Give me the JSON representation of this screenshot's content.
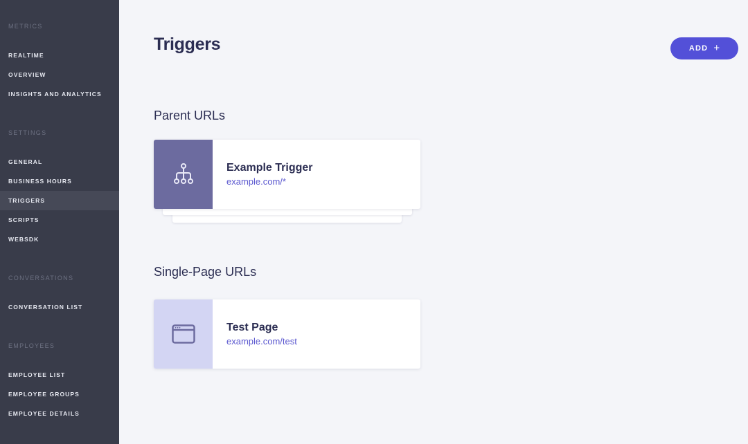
{
  "sidebar": {
    "sections": [
      {
        "header": "METRICS",
        "items": [
          "REALTIME",
          "OVERVIEW",
          "INSIGHTS AND ANALYTICS"
        ]
      },
      {
        "header": "SETTINGS",
        "items": [
          "GENERAL",
          "BUSINESS HOURS",
          "TRIGGERS",
          "SCRIPTS",
          "WEBSDK"
        ]
      },
      {
        "header": "CONVERSATIONS",
        "items": [
          "CONVERSATION LIST"
        ]
      },
      {
        "header": "EMPLOYEES",
        "items": [
          "EMPLOYEE LIST",
          "EMPLOYEE GROUPS",
          "EMPLOYEE DETAILS"
        ]
      }
    ],
    "active_item": "TRIGGERS"
  },
  "main": {
    "title": "Triggers",
    "add_button": {
      "label": "ADD",
      "icon": "plus-icon"
    },
    "parent_urls": {
      "title": "Parent URLs",
      "cards": [
        {
          "name": "Example Trigger",
          "url": "example.com/*",
          "icon": "sitemap-icon"
        }
      ]
    },
    "single_page_urls": {
      "title": "Single-Page URLs",
      "cards": [
        {
          "name": "Test Page",
          "url": "example.com/test",
          "icon": "browser-window-icon"
        }
      ]
    }
  },
  "colors": {
    "sidebar_bg": "#393c4a",
    "sidebar_active_bg": "#464957",
    "page_bg": "#f4f5f9",
    "accent": "#5350d8",
    "title_text": "#2b2d52",
    "link_text": "#5a57cf",
    "parent_icon_bg": "#6c6b9f",
    "single_page_icon_bg": "#d3d5f3"
  }
}
